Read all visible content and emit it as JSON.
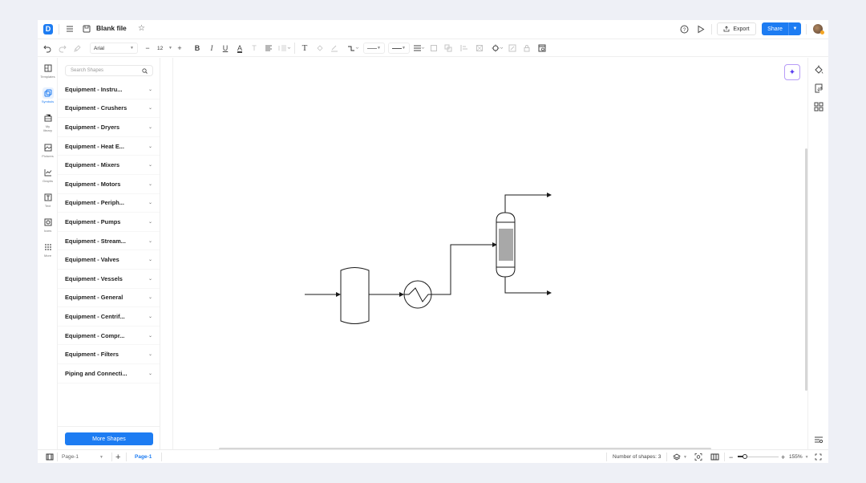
{
  "app": {
    "title": "Blank file",
    "logo_glyph": "D"
  },
  "header": {
    "export_label": "Export",
    "share_label": "Share",
    "icons": [
      "menu-icon",
      "file-icon",
      "star-icon",
      "help-icon",
      "play-icon",
      "export-icon",
      "avatar"
    ]
  },
  "toolbar": {
    "font_family": "Arial",
    "font_size": "12",
    "icons": [
      "undo",
      "redo",
      "format-painter",
      "font-size-decrease",
      "font-size-increase",
      "bold",
      "italic",
      "underline",
      "font-color",
      "strikethrough",
      "align",
      "line-spacing",
      "text",
      "fill",
      "line-color",
      "connector",
      "line-style",
      "arrow-style",
      "distribute",
      "group",
      "arrange",
      "align-shapes",
      "size",
      "shape-settings",
      "edit",
      "lock",
      "replace"
    ]
  },
  "rail": {
    "items": [
      {
        "label": "Templates",
        "icon": "templates-icon"
      },
      {
        "label": "Symbols",
        "icon": "symbols-icon",
        "active": true
      },
      {
        "label": "My library",
        "icon": "library-icon"
      },
      {
        "label": "Pictures",
        "icon": "pictures-icon"
      },
      {
        "label": "Graphs",
        "icon": "graphs-icon"
      },
      {
        "label": "Text",
        "icon": "text-icon"
      },
      {
        "label": "Icons",
        "icon": "icons-icon"
      },
      {
        "label": "More",
        "icon": "more-icon"
      }
    ]
  },
  "panel": {
    "search_placeholder": "Search Shapes",
    "categories": [
      "Equipment - Instru...",
      "Equipment - Crushers",
      "Equipment - Dryers",
      "Equipment - Heat E...",
      "Equipment - Mixers",
      "Equipment - Motors",
      "Equipment - Periph...",
      "Equipment - Pumps",
      "Equipment - Stream...",
      "Equipment - Valves",
      "Equipment - Vessels",
      "Equipment - General",
      "Equipment - Centrif...",
      "Equipment - Compr...",
      "Equipment - Filters",
      "Piping and Connecti..."
    ],
    "more_label": "More Shapes"
  },
  "canvas": {
    "shapes": [
      {
        "type": "vessel",
        "name": "storage-tank"
      },
      {
        "type": "heat-exchanger",
        "name": "heat-exchanger"
      },
      {
        "type": "column",
        "name": "packed-column"
      }
    ],
    "colors": {
      "stroke": "#1a1a1a",
      "packing": "#a8a8a8"
    }
  },
  "statusbar": {
    "page_select": "Page-1",
    "page_tab": "Page-1",
    "shape_count": "Number of shapes: 3",
    "zoom_level": "155%"
  },
  "colors": {
    "accent": "#1d7cf2",
    "ai_border": "#b79cf7"
  }
}
